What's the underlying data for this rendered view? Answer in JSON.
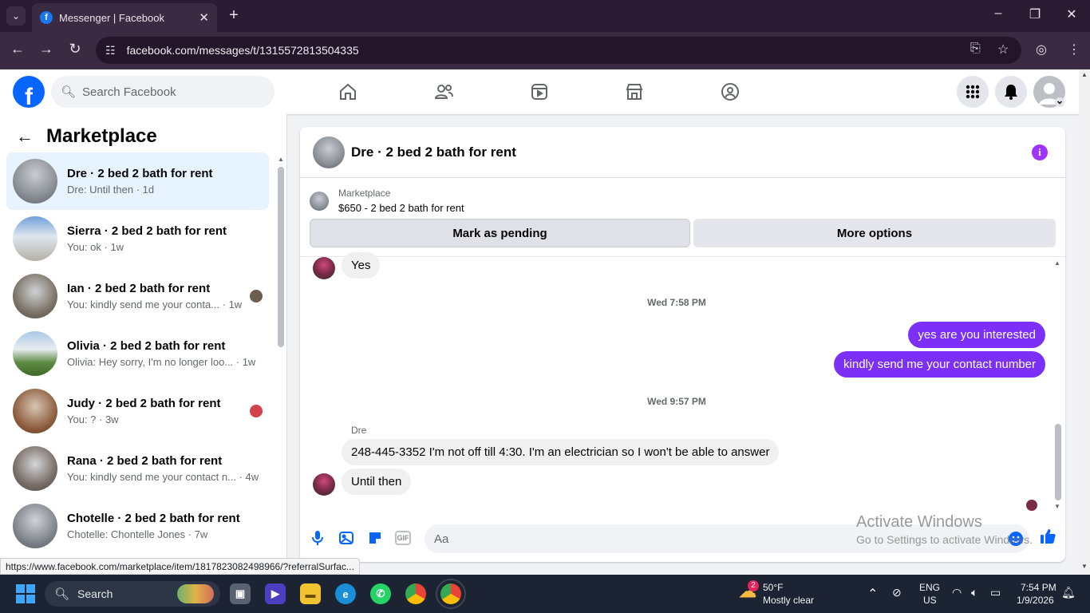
{
  "browser": {
    "tab_title": "Messenger | Facebook",
    "url": "facebook.com/messages/t/1315572813504335",
    "status_url": "https://www.facebook.com/marketplace/item/1817823082498966/?referralSurfac..."
  },
  "header": {
    "search_placeholder": "Search Facebook"
  },
  "sidebar": {
    "title": "Marketplace",
    "conversations": [
      {
        "name": "Dre · 2 bed 2 bath for rent",
        "snippet": "Dre: Until then · 1d",
        "active": true,
        "thumb_color": "#8a8f96"
      },
      {
        "name": "Sierra · 2 bed 2 bath for rent",
        "snippet": "You: ok · 1w",
        "thumb_color": "#9ab0c8"
      },
      {
        "name": "Ian · 2 bed 2 bath for rent",
        "snippet": "You: kindly send me your conta... · 1w",
        "thumb_color": "#7d7468"
      },
      {
        "name": "Olivia · 2 bed 2 bath for rent",
        "snippet": "Olivia: Hey sorry, I'm no longer loo... · 1w",
        "thumb_color": "#5d8a43"
      },
      {
        "name": "Judy · 2 bed 2 bath for rent",
        "snippet": "You: ? · 3w",
        "thumb_color": "#8a5a3a"
      },
      {
        "name": "Rana · 2 bed 2 bath for rent",
        "snippet": "You: kindly send me your contact n... · 4w",
        "thumb_color": "#7a6f68"
      },
      {
        "name": "Chotelle · 2 bed 2 bath for rent",
        "snippet": "Chotelle: Chontelle Jones · 7w",
        "thumb_color": "#80858c"
      }
    ]
  },
  "chat": {
    "title": "Dre · 2 bed 2 bath for rent",
    "marketplace_label": "Marketplace",
    "listing": "$650 - 2 bed 2 bath for rent",
    "mark_pending": "Mark as pending",
    "more_options": "More options",
    "msg_yes": "Yes",
    "ts1": "Wed 7:58 PM",
    "out1": "yes are you interested",
    "out2": "kindly send me your contact number",
    "ts2": "Wed 9:57 PM",
    "sender": "Dre",
    "in1": "248-445-3352 I'm not off till 4:30. I'm an electrician so I won't be able to answer",
    "in2": "Until then",
    "composer_placeholder": "Aa",
    "accent_color": "#7b2ff7"
  },
  "watermark": {
    "line1": "Activate Windows",
    "line2": "Go to Settings to activate Windows."
  },
  "taskbar": {
    "search": "Search",
    "weather_temp": "50°F",
    "weather_desc": "Mostly clear",
    "weather_badge": "2",
    "lang1": "ENG",
    "lang2": "US",
    "time": "7:54 PM",
    "date": "1/9/2026"
  }
}
